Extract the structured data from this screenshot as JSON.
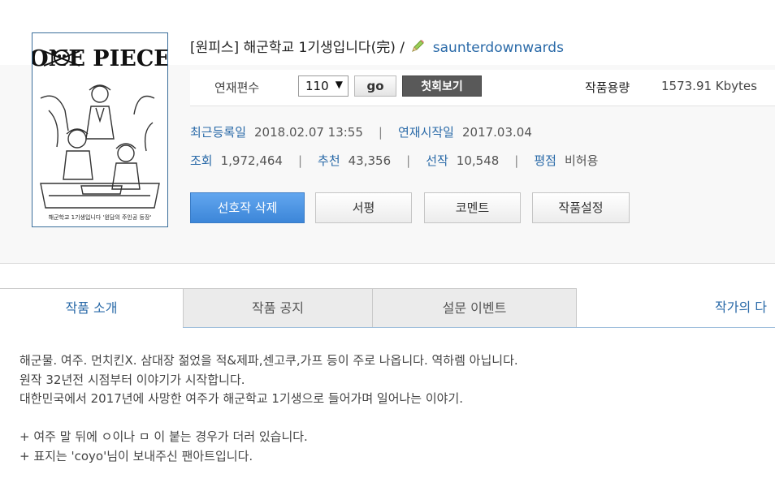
{
  "work": {
    "title": "[원피스] 해군학교 1기생입니다(完) /",
    "author": "saunterdownwards",
    "cover_logo": "ONE PIECE",
    "cover_caption": "해군학교 1기생입니다 '왼담의 주인공 등장'"
  },
  "meta_bar": {
    "episodes_label": "연재편수",
    "episode_selected": "110",
    "go_label": "go",
    "first_episode_label": "첫회보기",
    "size_label": "작품용량",
    "size_value": "1573.91 Kbytes"
  },
  "info": {
    "latest_label": "최근등록일",
    "latest_value": "2018.02.07 13:55",
    "start_label": "연재시작일",
    "start_value": "2017.03.04",
    "views_label": "조회",
    "views_value": "1,972,464",
    "recommend_label": "추천",
    "recommend_value": "43,356",
    "favorites_label": "선작",
    "favorites_value": "10,548",
    "rating_label": "평점",
    "rating_value": "비허용",
    "separator": "|"
  },
  "actions": {
    "remove_favorite": "선호작 삭제",
    "review": "서평",
    "comment": "코멘트",
    "settings": "작품설정"
  },
  "tabs": [
    {
      "label": "작품 소개"
    },
    {
      "label": "작품 공지"
    },
    {
      "label": "설문 이벤트"
    },
    {
      "label": "작가의 다"
    }
  ],
  "description": [
    "해군물. 여주. 먼치킨X. 삼대장 젊었을 적&제파,센고쿠,가프 등이 주로 나옵니다. 역하렘 아닙니다.",
    "원작 32년전 시점부터 이야기가 시작합니다.",
    "대한민국에서 2017년에 사망한 여주가 해군학교 1기생으로 들어가며 일어나는 이야기.",
    "",
    "+ 여주 말 뒤에 ㅇ이나 ㅁ 이 붙는 경우가 더러 있습니다.",
    "+ 표지는 'coyo'님이 보내주신 팬아트입니다."
  ],
  "colors": {
    "link_blue": "#2a6aa8",
    "primary_button": "#4a90e2",
    "dark_button": "#595959"
  }
}
